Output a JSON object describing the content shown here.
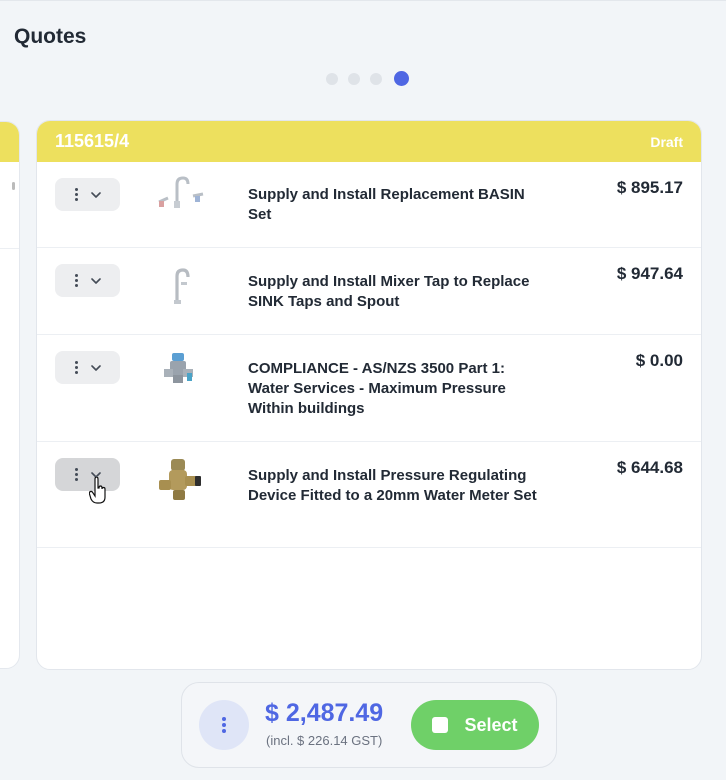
{
  "page": {
    "title": "Quotes"
  },
  "pagination": {
    "count": 4,
    "active_index": 4
  },
  "quote": {
    "id": "115615/4",
    "status": "Draft",
    "items": [
      {
        "description": "Supply and Install Replacement BASIN Set",
        "price": "$ 895.17",
        "image": "basin-set-tap-image"
      },
      {
        "description": "Supply and Install Mixer Tap to Replace SINK Taps and Spout",
        "price": "$ 947.64",
        "image": "mixer-tap-image"
      },
      {
        "description": "COMPLIANCE - AS/NZS 3500 Part 1: Water Services - Maximum Pressure Within buildings",
        "price": "$ 0.00",
        "image": "pressure-valve-image"
      },
      {
        "description": "Supply and Install Pressure Regulating Device Fitted to a 20mm Water Meter Set",
        "price": "$ 644.68",
        "image": "brass-pressure-regulator-image"
      }
    ]
  },
  "footer": {
    "total": "$ 2,487.49",
    "gst_note": "(incl. $ 226.14 GST)",
    "select_label": "Select"
  },
  "colors": {
    "accent": "#4f67e3",
    "header_yellow": "#ede05e",
    "select_green": "#6fd068"
  }
}
